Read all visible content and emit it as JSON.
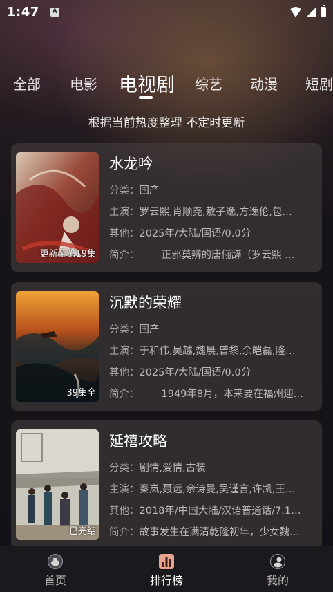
{
  "status_bar": {
    "time": "1:47",
    "notification_glyph": "A"
  },
  "tabs": [
    {
      "label": "全部"
    },
    {
      "label": "电影"
    },
    {
      "label": "电视剧",
      "active": true
    },
    {
      "label": "综艺"
    },
    {
      "label": "动漫"
    },
    {
      "label": "短剧"
    }
  ],
  "subtitle": "根据当前热度整理 不定时更新",
  "labels": {
    "category": "分类：",
    "cast": "主演：",
    "other": "其他：",
    "summary": "简介："
  },
  "cards": [
    {
      "title": "水龙吟",
      "category": "国产",
      "cast": "罗云熙,肖顺尧,敖子逸,方逸伦,包…",
      "other": "2025年/大陆/国语/0.0分",
      "summary": "正邪莫辨的唐俪辞（罗云熙 …",
      "badge": "更新至第19集"
    },
    {
      "title": "沉默的荣耀",
      "category": "国产",
      "cast": "于和伟,吴越,魏晨,曾黎,余皑磊,隆…",
      "other": "2025年/大陆/国语/0.0分",
      "summary": "1949年8月，本来要在福州迎…",
      "badge": "39集全"
    },
    {
      "title": "延禧攻略",
      "category": "剧情,爱情,古装",
      "cast": "秦岚,聂远,佘诗曼,吴谨言,许凯,王…",
      "other": "2018年/中国大陆/汉语普通话/7.1…",
      "summary": "故事发生在满清乾隆初年，少女魏…",
      "badge": "已完结"
    }
  ],
  "bottom_nav": [
    {
      "label": "首页",
      "icon": "home-teapot-icon"
    },
    {
      "label": "排行榜",
      "icon": "ranking-icon",
      "active": true
    },
    {
      "label": "我的",
      "icon": "profile-icon"
    }
  ],
  "colors": {
    "accent_rank": "#e9a38f",
    "background": "#15131a",
    "card": "#3d3838"
  }
}
